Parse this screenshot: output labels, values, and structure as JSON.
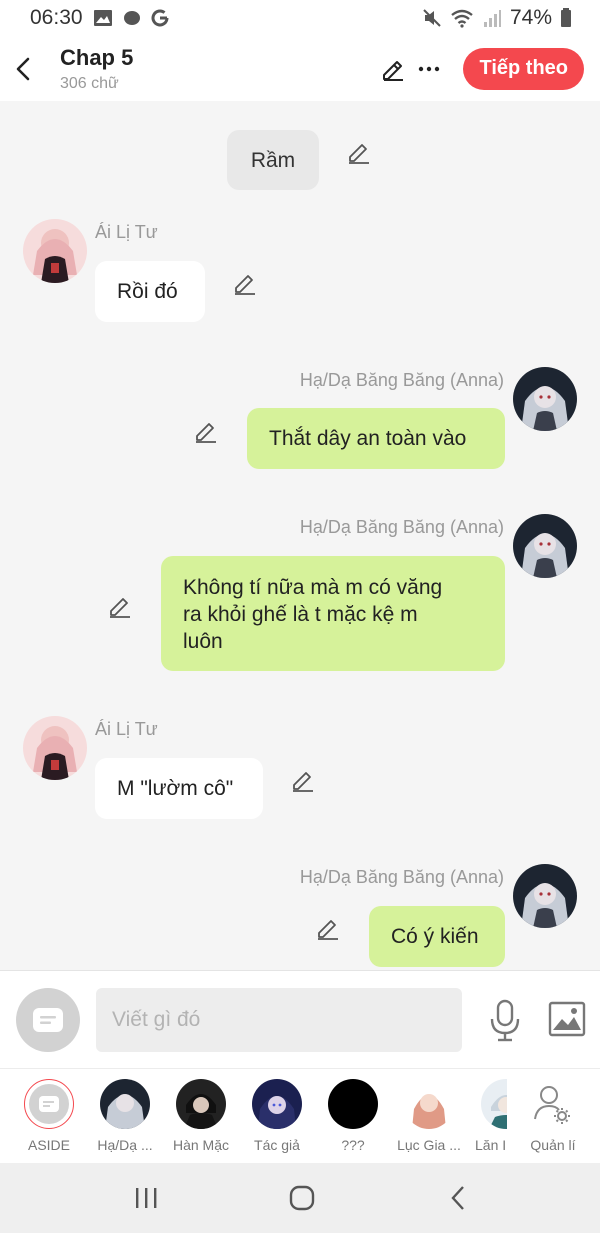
{
  "status_bar": {
    "time": "06:30",
    "battery": "74%",
    "icons": [
      "image-icon",
      "chat-dot-icon",
      "google-icon",
      "mute-icon",
      "wifi-icon",
      "signal-icon",
      "battery-icon"
    ]
  },
  "header": {
    "title": "Chap 5",
    "subtitle": "306 chữ",
    "next_button": "Tiếp theo",
    "accent": "#f4484e"
  },
  "chat": {
    "messages": [
      {
        "type": "narration",
        "text": "Rầm"
      },
      {
        "type": "left",
        "sender": "Ái Lị Tư",
        "text": "Rồi đó"
      },
      {
        "type": "right",
        "sender": "Hạ/Dạ Băng Băng (Anna)",
        "text": "Thắt dây an toàn vào"
      },
      {
        "type": "right",
        "sender": "Hạ/Dạ Băng Băng (Anna)",
        "text": "Không tí nữa mà m có văng ra khỏi ghế là t mặc kệ m luôn",
        "lines": [
          "Không tí nữa mà m có văng",
          "ra khỏi ghế là t mặc kệ m",
          "luôn"
        ]
      },
      {
        "type": "left",
        "sender": "Ái Lị Tư",
        "text": "M \"lườm cô\""
      },
      {
        "type": "right",
        "sender": "Hạ/Dạ Băng Băng (Anna)",
        "text": "Có ý kiến"
      }
    ],
    "right_bubble_color": "#d6f29a",
    "left_bubble_color": "#ffffff"
  },
  "input": {
    "placeholder": "Viết gì đó"
  },
  "characters": [
    {
      "name": "ASIDE"
    },
    {
      "name": "Hạ/Dạ ..."
    },
    {
      "name": "Hàn Mặc"
    },
    {
      "name": "Tác giả"
    },
    {
      "name": "???"
    },
    {
      "name": "Lục Gia ..."
    },
    {
      "name": "Lăn I"
    },
    {
      "name": "Quản lí"
    }
  ]
}
